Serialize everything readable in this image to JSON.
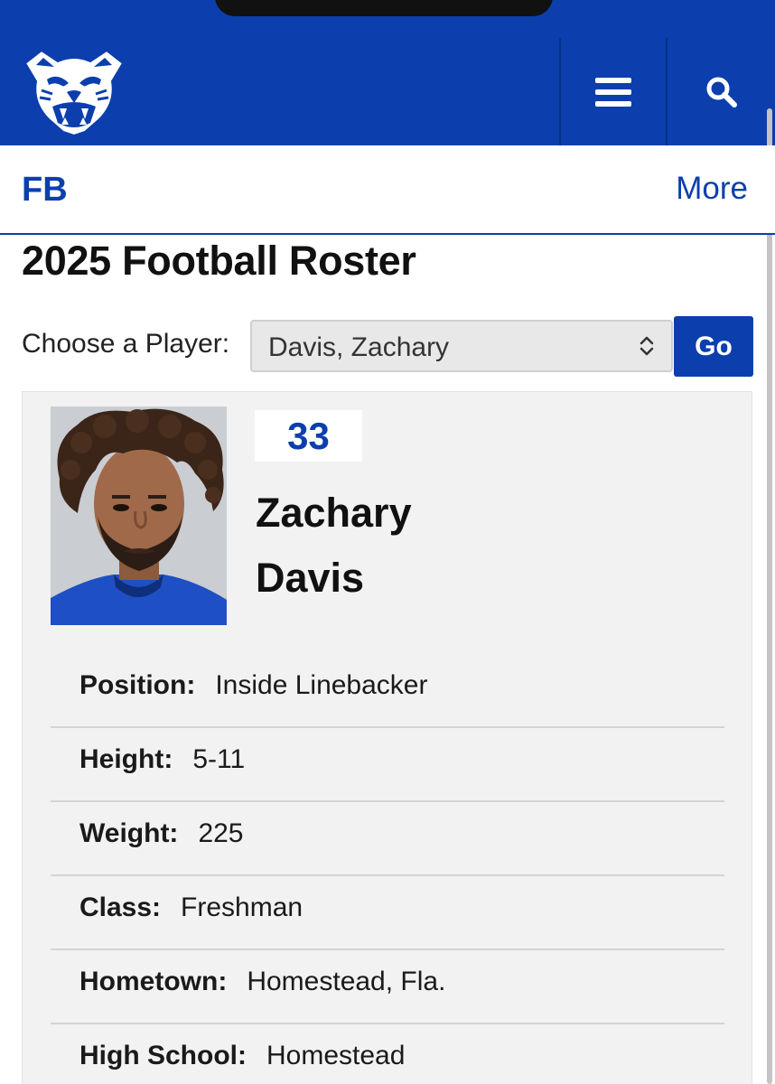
{
  "header": {
    "logo_icon": "panther-head-logo",
    "menu_icon": "hamburger-menu-icon",
    "search_icon": "search-icon",
    "bg_color": "#0c3fad"
  },
  "subnav": {
    "title": "FB",
    "more_label": "More"
  },
  "page": {
    "title": "2025 Football Roster"
  },
  "chooser": {
    "label": "Choose a Player:",
    "selected": "Davis, Zachary",
    "go_label": "Go"
  },
  "player": {
    "number": "33",
    "first_name": "Zachary",
    "last_name": "Davis",
    "details": [
      {
        "label": "Position:",
        "value": "Inside Linebacker"
      },
      {
        "label": "Height:",
        "value": "5-11"
      },
      {
        "label": "Weight:",
        "value": "225"
      },
      {
        "label": "Class:",
        "value": "Freshman"
      },
      {
        "label": "Hometown:",
        "value": "Homestead, Fla."
      },
      {
        "label": "High School:",
        "value": "Homestead"
      }
    ]
  },
  "colors": {
    "brand_blue": "#0c3fad",
    "card_bg": "#f2f2f2"
  }
}
